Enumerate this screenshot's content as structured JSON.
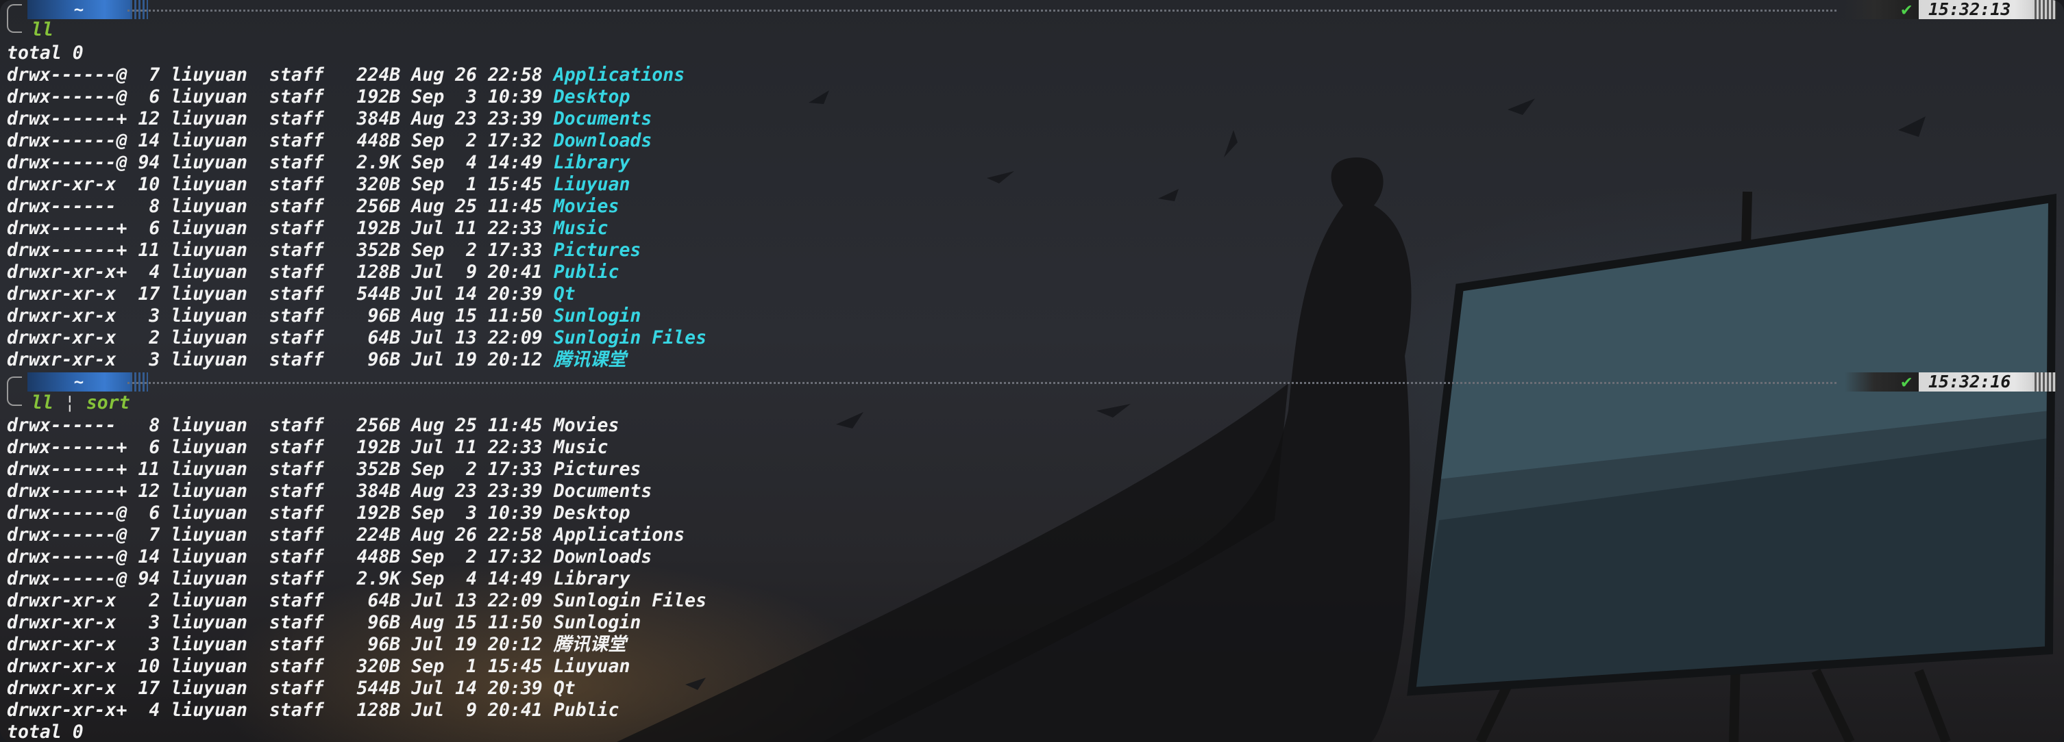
{
  "theme": {
    "dir_color": "#37d6e3",
    "cmd_color": "#86c33a",
    "prompt_dir_bg": "#2a5fa6",
    "check_color": "#4fd24a",
    "time_bg": "#e6e6e6"
  },
  "blocks": [
    {
      "prompt": {
        "dir": "~",
        "status_icon": "check-icon",
        "status_glyph": "✔",
        "time": "15:32:13"
      },
      "command": {
        "cmd": "ll",
        "pipe": "",
        "pipe_cmd": ""
      },
      "total": "total 0",
      "rows": [
        {
          "perms": "drwx------@",
          "links": "7",
          "owner": "liuyuan",
          "group": "staff",
          "size": "224B",
          "month": "Aug",
          "day": "26",
          "time": "22:58",
          "name": "Applications"
        },
        {
          "perms": "drwx------@",
          "links": "6",
          "owner": "liuyuan",
          "group": "staff",
          "size": "192B",
          "month": "Sep",
          "day": "3",
          "time": "10:39",
          "name": "Desktop"
        },
        {
          "perms": "drwx------+",
          "links": "12",
          "owner": "liuyuan",
          "group": "staff",
          "size": "384B",
          "month": "Aug",
          "day": "23",
          "time": "23:39",
          "name": "Documents"
        },
        {
          "perms": "drwx------@",
          "links": "14",
          "owner": "liuyuan",
          "group": "staff",
          "size": "448B",
          "month": "Sep",
          "day": "2",
          "time": "17:32",
          "name": "Downloads"
        },
        {
          "perms": "drwx------@",
          "links": "94",
          "owner": "liuyuan",
          "group": "staff",
          "size": "2.9K",
          "month": "Sep",
          "day": "4",
          "time": "14:49",
          "name": "Library"
        },
        {
          "perms": "drwxr-xr-x",
          "links": "10",
          "owner": "liuyuan",
          "group": "staff",
          "size": "320B",
          "month": "Sep",
          "day": "1",
          "time": "15:45",
          "name": "Liuyuan"
        },
        {
          "perms": "drwx------",
          "links": "8",
          "owner": "liuyuan",
          "group": "staff",
          "size": "256B",
          "month": "Aug",
          "day": "25",
          "time": "11:45",
          "name": "Movies"
        },
        {
          "perms": "drwx------+",
          "links": "6",
          "owner": "liuyuan",
          "group": "staff",
          "size": "192B",
          "month": "Jul",
          "day": "11",
          "time": "22:33",
          "name": "Music"
        },
        {
          "perms": "drwx------+",
          "links": "11",
          "owner": "liuyuan",
          "group": "staff",
          "size": "352B",
          "month": "Sep",
          "day": "2",
          "time": "17:33",
          "name": "Pictures"
        },
        {
          "perms": "drwxr-xr-x+",
          "links": "4",
          "owner": "liuyuan",
          "group": "staff",
          "size": "128B",
          "month": "Jul",
          "day": "9",
          "time": "20:41",
          "name": "Public"
        },
        {
          "perms": "drwxr-xr-x",
          "links": "17",
          "owner": "liuyuan",
          "group": "staff",
          "size": "544B",
          "month": "Jul",
          "day": "14",
          "time": "20:39",
          "name": "Qt"
        },
        {
          "perms": "drwxr-xr-x",
          "links": "3",
          "owner": "liuyuan",
          "group": "staff",
          "size": "96B",
          "month": "Aug",
          "day": "15",
          "time": "11:50",
          "name": "Sunlogin"
        },
        {
          "perms": "drwxr-xr-x",
          "links": "2",
          "owner": "liuyuan",
          "group": "staff",
          "size": "64B",
          "month": "Jul",
          "day": "13",
          "time": "22:09",
          "name": "Sunlogin Files"
        },
        {
          "perms": "drwxr-xr-x",
          "links": "3",
          "owner": "liuyuan",
          "group": "staff",
          "size": "96B",
          "month": "Jul",
          "day": "19",
          "time": "20:12",
          "name": "腾讯课堂"
        }
      ]
    },
    {
      "prompt": {
        "dir": "~",
        "status_icon": "check-icon",
        "status_glyph": "✔",
        "time": "15:32:16"
      },
      "command": {
        "cmd": "ll",
        "pipe": "¦",
        "pipe_cmd": "sort"
      },
      "total": "",
      "rows": [
        {
          "perms": "drwx------",
          "links": "8",
          "owner": "liuyuan",
          "group": "staff",
          "size": "256B",
          "month": "Aug",
          "day": "25",
          "time": "11:45",
          "name": "Movies"
        },
        {
          "perms": "drwx------+",
          "links": "6",
          "owner": "liuyuan",
          "group": "staff",
          "size": "192B",
          "month": "Jul",
          "day": "11",
          "time": "22:33",
          "name": "Music"
        },
        {
          "perms": "drwx------+",
          "links": "11",
          "owner": "liuyuan",
          "group": "staff",
          "size": "352B",
          "month": "Sep",
          "day": "2",
          "time": "17:33",
          "name": "Pictures"
        },
        {
          "perms": "drwx------+",
          "links": "12",
          "owner": "liuyuan",
          "group": "staff",
          "size": "384B",
          "month": "Aug",
          "day": "23",
          "time": "23:39",
          "name": "Documents"
        },
        {
          "perms": "drwx------@",
          "links": "6",
          "owner": "liuyuan",
          "group": "staff",
          "size": "192B",
          "month": "Sep",
          "day": "3",
          "time": "10:39",
          "name": "Desktop"
        },
        {
          "perms": "drwx------@",
          "links": "7",
          "owner": "liuyuan",
          "group": "staff",
          "size": "224B",
          "month": "Aug",
          "day": "26",
          "time": "22:58",
          "name": "Applications"
        },
        {
          "perms": "drwx------@",
          "links": "14",
          "owner": "liuyuan",
          "group": "staff",
          "size": "448B",
          "month": "Sep",
          "day": "2",
          "time": "17:32",
          "name": "Downloads"
        },
        {
          "perms": "drwx------@",
          "links": "94",
          "owner": "liuyuan",
          "group": "staff",
          "size": "2.9K",
          "month": "Sep",
          "day": "4",
          "time": "14:49",
          "name": "Library"
        },
        {
          "perms": "drwxr-xr-x",
          "links": "2",
          "owner": "liuyuan",
          "group": "staff",
          "size": "64B",
          "month": "Jul",
          "day": "13",
          "time": "22:09",
          "name": "Sunlogin Files"
        },
        {
          "perms": "drwxr-xr-x",
          "links": "3",
          "owner": "liuyuan",
          "group": "staff",
          "size": "96B",
          "month": "Aug",
          "day": "15",
          "time": "11:50",
          "name": "Sunlogin"
        },
        {
          "perms": "drwxr-xr-x",
          "links": "3",
          "owner": "liuyuan",
          "group": "staff",
          "size": "96B",
          "month": "Jul",
          "day": "19",
          "time": "20:12",
          "name": "腾讯课堂"
        },
        {
          "perms": "drwxr-xr-x",
          "links": "10",
          "owner": "liuyuan",
          "group": "staff",
          "size": "320B",
          "month": "Sep",
          "day": "1",
          "time": "15:45",
          "name": "Liuyuan"
        },
        {
          "perms": "drwxr-xr-x",
          "links": "17",
          "owner": "liuyuan",
          "group": "staff",
          "size": "544B",
          "month": "Jul",
          "day": "14",
          "time": "20:39",
          "name": "Qt"
        },
        {
          "perms": "drwxr-xr-x+",
          "links": "4",
          "owner": "liuyuan",
          "group": "staff",
          "size": "128B",
          "month": "Jul",
          "day": "9",
          "time": "20:41",
          "name": "Public"
        }
      ],
      "trailing_total": "total 0"
    }
  ]
}
